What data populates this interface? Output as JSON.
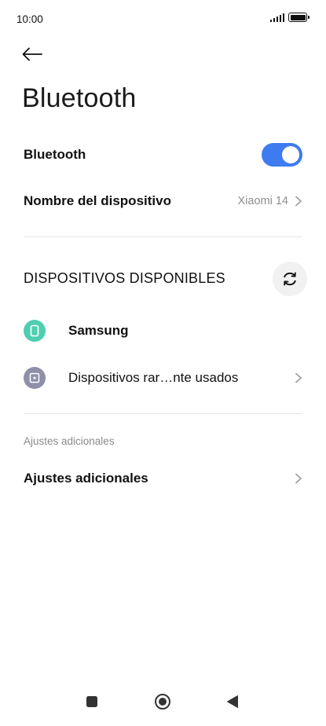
{
  "status_bar": {
    "time": "10:00"
  },
  "header": {
    "title": "Bluetooth"
  },
  "bluetooth_toggle": {
    "label": "Bluetooth",
    "on": true
  },
  "device_name_row": {
    "label": "Nombre del dispositivo",
    "value": "Xiaomi 14"
  },
  "available_devices": {
    "title": "DISPOSITIVOS DISPONIBLES",
    "items": [
      {
        "name": "Samsung",
        "icon": "phone-icon",
        "color": "#4fcfb0"
      },
      {
        "name": "Dispositivos rar…nte usados",
        "icon": "device-box-icon",
        "color": "#8f8fa8"
      }
    ]
  },
  "additional": {
    "subheading": "Ajustes adicionales",
    "label": "Ajustes adicionales"
  },
  "colors": {
    "accent": "#3e7bf0"
  }
}
